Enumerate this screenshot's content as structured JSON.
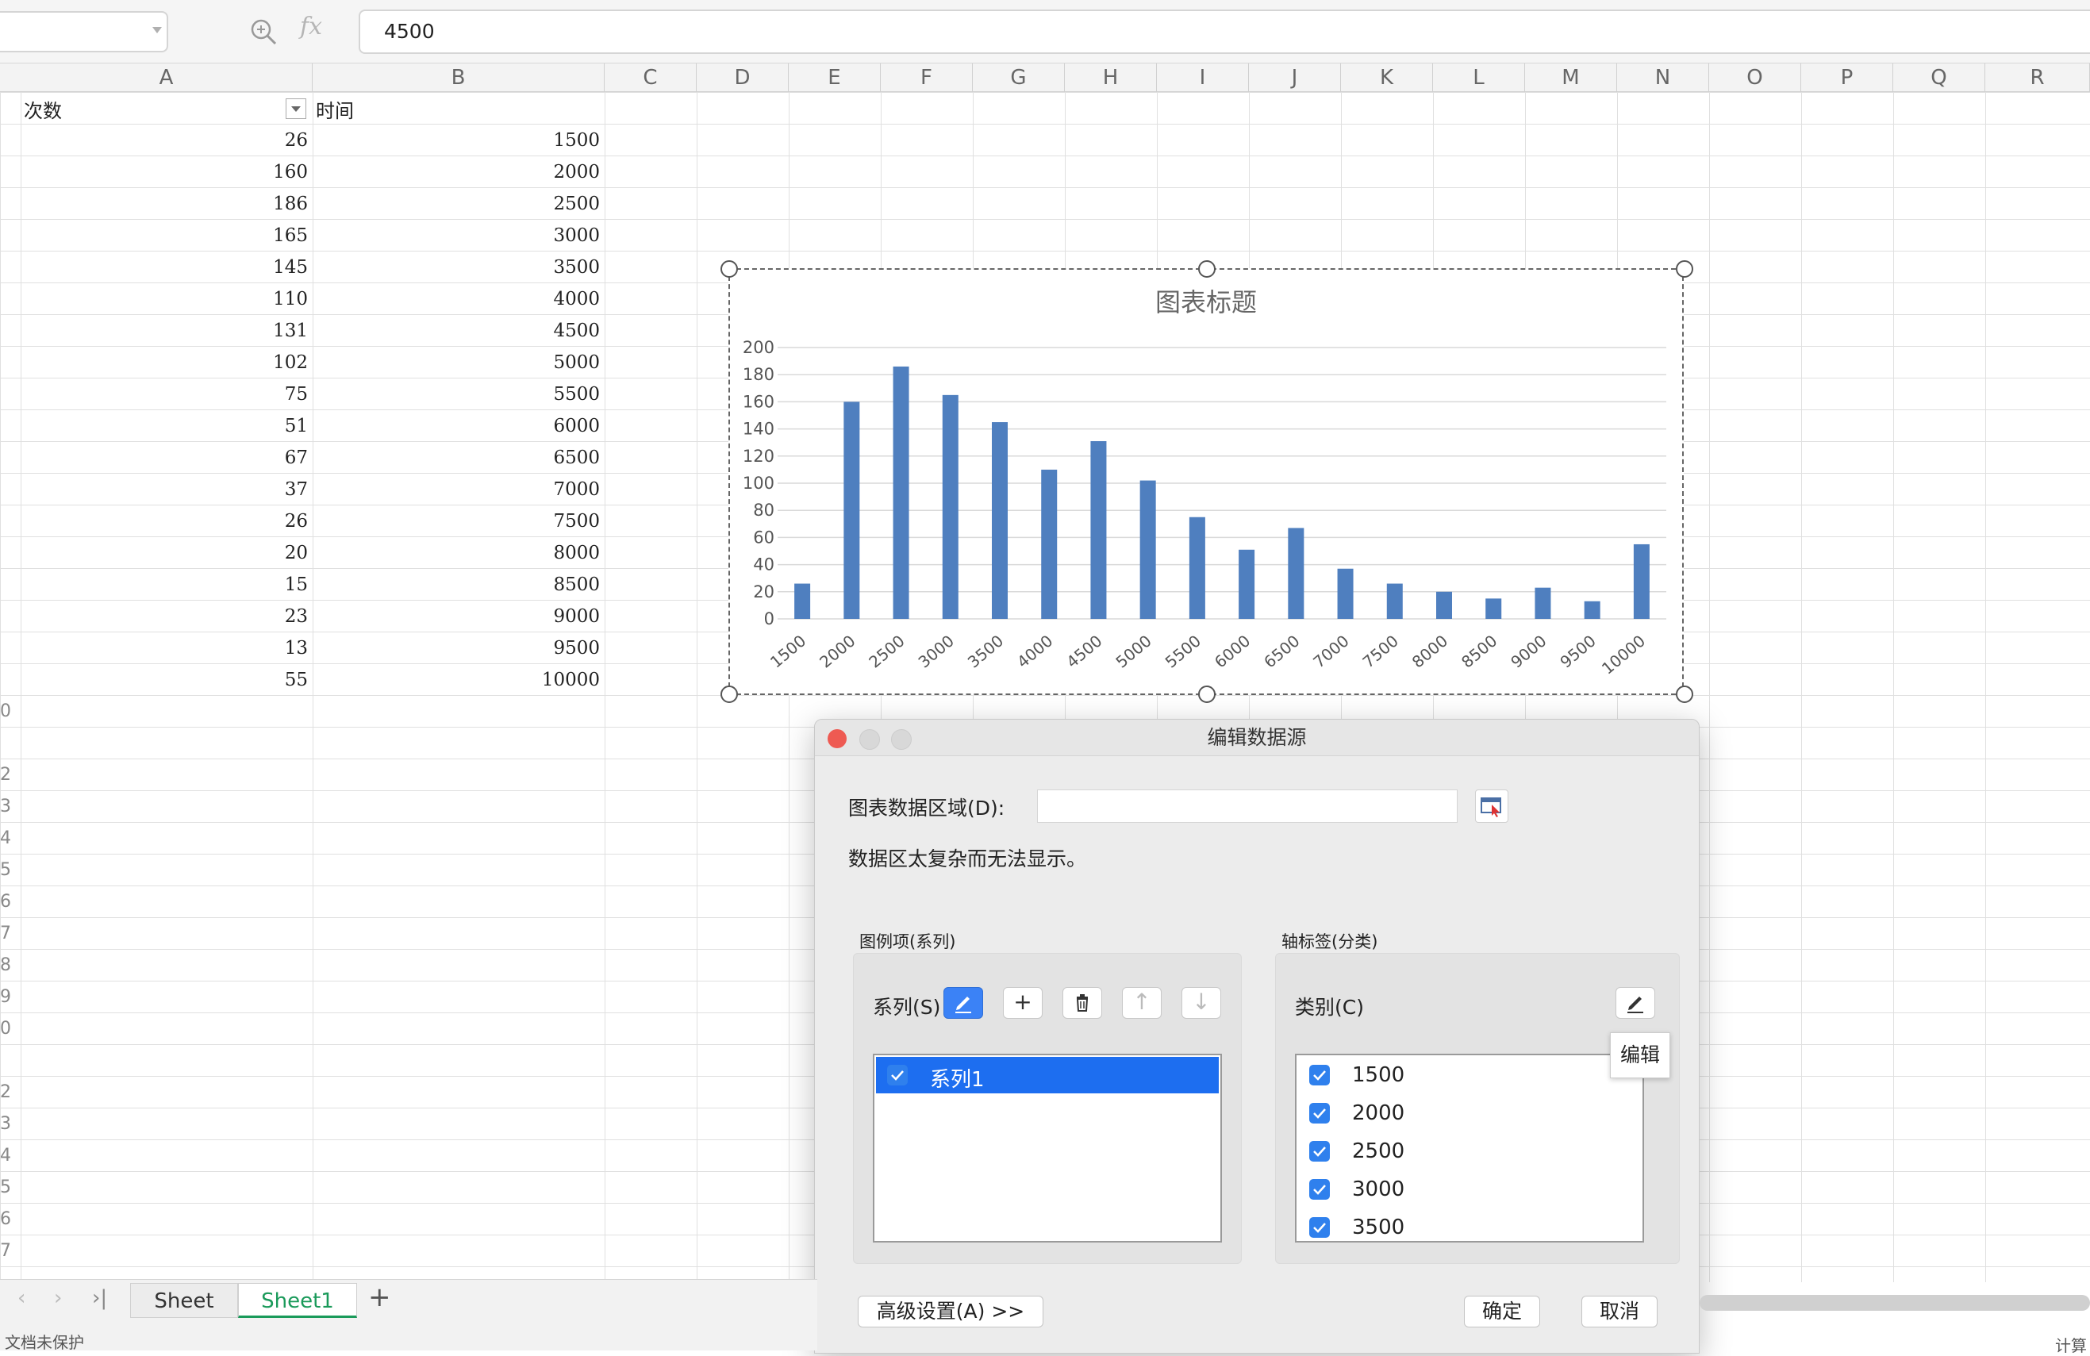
{
  "formula_bar": {
    "name_box": "",
    "fx": "fx",
    "value": "4500"
  },
  "columns": [
    "A",
    "B",
    "C",
    "D",
    "E",
    "F",
    "G",
    "H",
    "I",
    "J",
    "K",
    "L",
    "M",
    "N",
    "O",
    "P",
    "Q",
    "R"
  ],
  "table": {
    "headers": [
      "次数",
      "时间"
    ],
    "rows": [
      [
        "26",
        "1500"
      ],
      [
        "160",
        "2000"
      ],
      [
        "186",
        "2500"
      ],
      [
        "165",
        "3000"
      ],
      [
        "145",
        "3500"
      ],
      [
        "110",
        "4000"
      ],
      [
        "131",
        "4500"
      ],
      [
        "102",
        "5000"
      ],
      [
        "75",
        "5500"
      ],
      [
        "51",
        "6000"
      ],
      [
        "67",
        "6500"
      ],
      [
        "37",
        "7000"
      ],
      [
        "26",
        "7500"
      ],
      [
        "20",
        "8000"
      ],
      [
        "15",
        "8500"
      ],
      [
        "23",
        "9000"
      ],
      [
        "13",
        "9500"
      ],
      [
        "55",
        "10000"
      ]
    ]
  },
  "row_numbers": [
    "0",
    "",
    "2",
    "3",
    "4",
    "5",
    "6",
    "7",
    "8",
    "9",
    "0",
    "",
    "2",
    "3",
    "4",
    "5",
    "6",
    "7"
  ],
  "chart_data": {
    "type": "bar",
    "title": "图表标题",
    "categories": [
      "1500",
      "2000",
      "2500",
      "3000",
      "3500",
      "4000",
      "4500",
      "5000",
      "5500",
      "6000",
      "6500",
      "7000",
      "7500",
      "8000",
      "8500",
      "9000",
      "9500",
      "10000"
    ],
    "series": [
      {
        "values": [
          26,
          160,
          186,
          165,
          145,
          110,
          131,
          102,
          75,
          51,
          67,
          37,
          26,
          20,
          15,
          23,
          13,
          55
        ]
      }
    ],
    "ylim": [
      0,
      200
    ],
    "yticks": [
      0,
      20,
      40,
      60,
      80,
      100,
      120,
      140,
      160,
      180,
      200
    ],
    "grid": true,
    "color": "#4f7fbf"
  },
  "dialog": {
    "title": "编辑数据源",
    "range_label": "图表数据区域(D):",
    "range_value": "",
    "message": "数据区太复杂而无法显示。",
    "legend_group_title": "图例项(系列)",
    "axis_group_title": "轴标签(分类)",
    "series_label": "系列(S)",
    "category_label": "类别(C)",
    "series_items": [
      "系列1"
    ],
    "category_items": [
      "1500",
      "2000",
      "2500",
      "3000",
      "3500"
    ],
    "tooltip": "编辑",
    "advanced_button": "高级设置(A) >>",
    "ok_button": "确定",
    "cancel_button": "取消"
  },
  "sheet_tabs": [
    "Sheet",
    "Sheet1"
  ],
  "status": {
    "protect_text": "文档未保护",
    "right_text": "计算"
  }
}
